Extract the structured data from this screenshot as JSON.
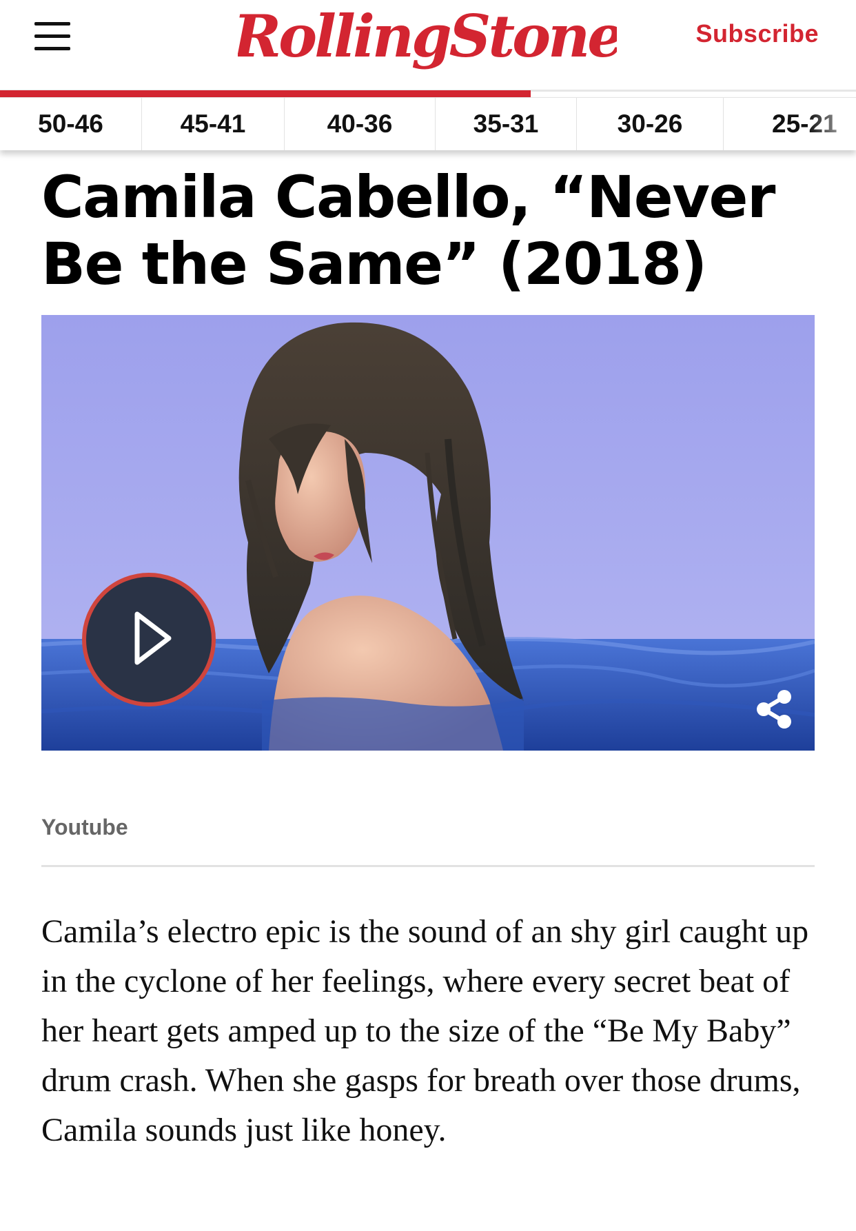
{
  "header": {
    "logo_text": "RollingStone",
    "subscribe_label": "Subscribe",
    "reading_progress_percent": 62
  },
  "nav": {
    "items": [
      "50-46",
      "45-41",
      "40-36",
      "35-31",
      "30-26",
      "25-21"
    ]
  },
  "article": {
    "title": "Camila Cabello, “Never Be the Same” (2018)",
    "video": {
      "play_icon": "play-icon",
      "share_icon": "share-icon"
    },
    "caption": "Youtube",
    "body": "Camila’s electro epic is the sound of an shy girl caught up in the cyclone of her feelings, where every secret beat of her heart gets amped up to the size of the “Be My Baby” drum crash. When she gasps for breath over those drums, Camila sounds just like honey."
  },
  "colors": {
    "brand_red": "#d32531",
    "play_button_fill": "#2a3346",
    "play_button_ring": "#d0453d"
  }
}
